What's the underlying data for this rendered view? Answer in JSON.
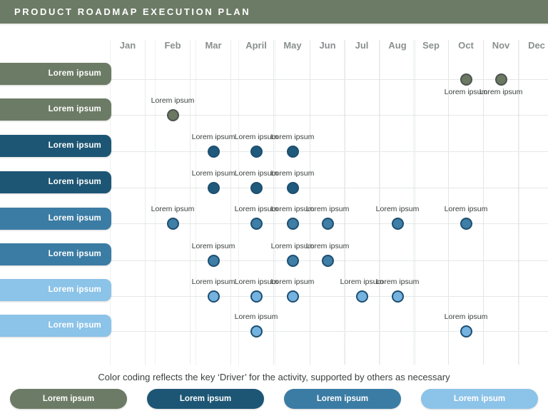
{
  "header": {
    "title": "PRODUCT ROADMAP EXECUTION PLAN",
    "bar_color": "#6c7b65"
  },
  "timeline": {
    "months": [
      "Jan",
      "Feb",
      "Mar",
      "April",
      "May",
      "Jun",
      "Jul",
      "Aug",
      "Sep",
      "Oct",
      "Nov",
      "Dec"
    ]
  },
  "palette": {
    "green": "#6c7b65",
    "dark_blue": "#1d5674",
    "mid_blue": "#3b7ca4",
    "light_blue": "#8cc3e8",
    "dot_green": "#6b7862",
    "dot_dark_blue": "#1f5a7c",
    "dot_mid_blue": "#3f7ea6",
    "dot_light_blue": "#74b2e0",
    "dot_ring_dark": "#4c5450",
    "dot_ring_navy": "#1e4f70",
    "label_text": "#3b3f3f",
    "month_text": "#8a8f8f",
    "gridline": "#e6e8e8"
  },
  "rows": [
    {
      "label": "Lorem ipsum",
      "tier": "green",
      "markers": [
        {
          "label": "Lorem ipsum",
          "month": "Oct",
          "label_position": "below"
        },
        {
          "label": "Lorem ipsum",
          "month": "Nov",
          "label_position": "below"
        }
      ]
    },
    {
      "label": "Lorem ipsum",
      "tier": "green",
      "markers": [
        {
          "label": "Lorem ipsum",
          "month": "Feb",
          "label_position": "above"
        }
      ]
    },
    {
      "label": "Lorem ipsum",
      "tier": "dark_blue",
      "markers": [
        {
          "label": "Lorem ipsum",
          "month": "Mar",
          "label_position": "above"
        },
        {
          "label": "Lorem ipsum",
          "month": "April",
          "label_position": "above"
        },
        {
          "label": "Lorem ipsum",
          "month": "May",
          "label_position": "above"
        }
      ]
    },
    {
      "label": "Lorem ipsum",
      "tier": "dark_blue",
      "markers": [
        {
          "label": "Lorem ipsum",
          "month": "Mar",
          "label_position": "above"
        },
        {
          "label": "Lorem ipsum",
          "month": "April",
          "label_position": "above"
        },
        {
          "label": "Lorem ipsum",
          "month": "May",
          "label_position": "above"
        }
      ]
    },
    {
      "label": "Lorem ipsum",
      "tier": "mid_blue",
      "markers": [
        {
          "label": "Lorem ipsum",
          "month": "Feb",
          "label_position": "above"
        },
        {
          "label": "Lorem ipsum",
          "month": "April",
          "label_position": "above"
        },
        {
          "label": "Lorem ipsum",
          "month": "May",
          "label_position": "above"
        },
        {
          "label": "Lorem ipsum",
          "month": "Jun",
          "label_position": "above"
        },
        {
          "label": "Lorem ipsum",
          "month": "Aug",
          "label_position": "above"
        },
        {
          "label": "Lorem ipsum",
          "month": "Oct",
          "label_position": "above"
        }
      ]
    },
    {
      "label": "Lorem ipsum",
      "tier": "mid_blue",
      "markers": [
        {
          "label": "Lorem ipsum",
          "month": "Mar",
          "label_position": "above"
        },
        {
          "label": "Lorem ipsum",
          "month": "May",
          "label_position": "above"
        },
        {
          "label": "Lorem ipsum",
          "month": "Jun",
          "label_position": "above"
        }
      ]
    },
    {
      "label": "Lorem ipsum",
      "tier": "light_blue",
      "markers": [
        {
          "label": "Lorem ipsum",
          "month": "Mar",
          "label_position": "above"
        },
        {
          "label": "Lorem ipsum",
          "month": "April",
          "label_position": "above"
        },
        {
          "label": "Lorem ipsum",
          "month": "May",
          "label_position": "above"
        },
        {
          "label": "Lorem ipsum",
          "month": "Jul",
          "label_position": "above"
        },
        {
          "label": "Lorem ipsum",
          "month": "Aug",
          "label_position": "above"
        }
      ]
    },
    {
      "label": "Lorem ipsum",
      "tier": "light_blue",
      "markers": [
        {
          "label": "Lorem ipsum",
          "month": "April",
          "label_position": "above"
        },
        {
          "label": "Lorem ipsum",
          "month": "Oct",
          "label_position": "above"
        }
      ]
    }
  ],
  "footer": {
    "caption": "Color coding reflects the key ‘Driver’ for the activity, supported by others as necessary",
    "legend": [
      {
        "label": "Lorem ipsum",
        "tier": "green"
      },
      {
        "label": "Lorem ipsum",
        "tier": "dark_blue"
      },
      {
        "label": "Lorem ipsum",
        "tier": "mid_blue"
      },
      {
        "label": "Lorem ipsum",
        "tier": "light_blue"
      }
    ]
  },
  "chart_data": {
    "type": "scatter",
    "title": "PRODUCT ROADMAP EXECUTION PLAN",
    "xlabel": "",
    "ylabel": "",
    "x": [
      "Jan",
      "Feb",
      "Mar",
      "April",
      "May",
      "Jun",
      "Jul",
      "Aug",
      "Sep",
      "Oct",
      "Nov",
      "Dec"
    ],
    "categories": [
      "Lorem ipsum",
      "Lorem ipsum",
      "Lorem ipsum",
      "Lorem ipsum",
      "Lorem ipsum",
      "Lorem ipsum",
      "Lorem ipsum",
      "Lorem ipsum"
    ],
    "grid": true,
    "legend_position": "bottom",
    "series": [
      {
        "name": "Lorem ipsum",
        "tier": "green",
        "row": 1,
        "months": [
          "Oct",
          "Nov"
        ]
      },
      {
        "name": "Lorem ipsum",
        "tier": "green",
        "row": 2,
        "months": [
          "Feb"
        ]
      },
      {
        "name": "Lorem ipsum",
        "tier": "dark_blue",
        "row": 3,
        "months": [
          "Mar",
          "April",
          "May"
        ]
      },
      {
        "name": "Lorem ipsum",
        "tier": "dark_blue",
        "row": 4,
        "months": [
          "Mar",
          "April",
          "May"
        ]
      },
      {
        "name": "Lorem ipsum",
        "tier": "mid_blue",
        "row": 5,
        "months": [
          "Feb",
          "April",
          "May",
          "Jun",
          "Aug",
          "Oct"
        ]
      },
      {
        "name": "Lorem ipsum",
        "tier": "mid_blue",
        "row": 6,
        "months": [
          "Mar",
          "May",
          "Jun"
        ]
      },
      {
        "name": "Lorem ipsum",
        "tier": "light_blue",
        "row": 7,
        "months": [
          "Mar",
          "April",
          "May",
          "Jul",
          "Aug"
        ]
      },
      {
        "name": "Lorem ipsum",
        "tier": "light_blue",
        "row": 8,
        "months": [
          "April",
          "Oct"
        ]
      }
    ]
  }
}
